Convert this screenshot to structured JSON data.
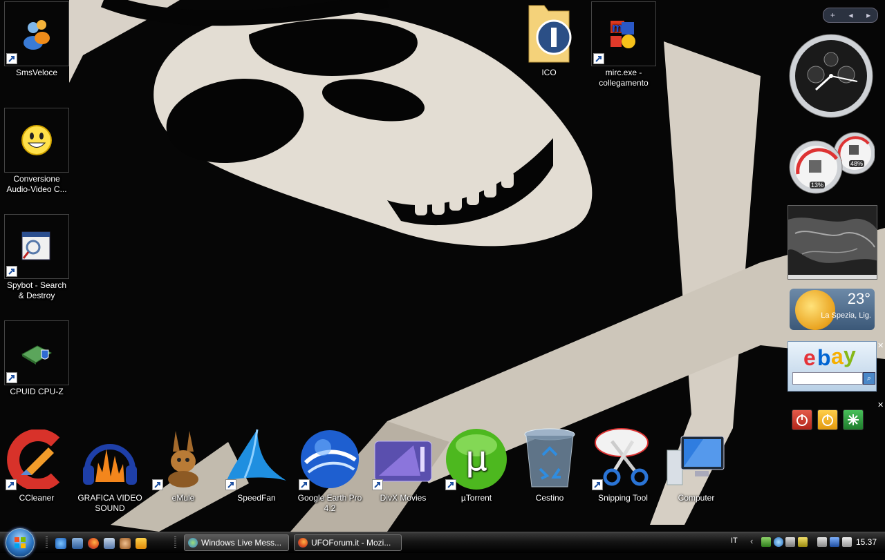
{
  "desktop": {
    "left_icons": [
      {
        "label": "SmsVeloce"
      },
      {
        "label": "Conversione Audio-Video C..."
      },
      {
        "label": "Spybot - Search & Destroy"
      },
      {
        "label": "CPUID CPU-Z"
      }
    ],
    "top_icons": [
      {
        "label": "ICO"
      },
      {
        "label": "mirc.exe - collegamento"
      }
    ],
    "bottom_icons": [
      {
        "label": "CCleaner"
      },
      {
        "label": "GRAFICA VIDEO SOUND"
      },
      {
        "label": "eMule"
      },
      {
        "label": "SpeedFan"
      },
      {
        "label": "Google Earth Pro 4.2"
      },
      {
        "label": "DivX Movies"
      },
      {
        "label": "µTorrent"
      },
      {
        "label": "Cestino"
      },
      {
        "label": "Snipping Tool"
      },
      {
        "label": "Computer"
      }
    ]
  },
  "sidebar": {
    "controls": {
      "add": "+",
      "prev": "◂",
      "next": "▸"
    },
    "cpu_meter": {
      "cpu": "13%",
      "memory": "48%"
    },
    "weather": {
      "temperature": "23°",
      "location": "La Spezia, Lig."
    },
    "ebay_logo": "ebay",
    "close_glyph": "✕"
  },
  "taskbar": {
    "buttons": [
      {
        "label": "Windows Live Mess..."
      },
      {
        "label": "UFOForum.it - Mozi..."
      }
    ],
    "language": "IT",
    "tray_arrow": "‹",
    "clock": "15.37"
  }
}
